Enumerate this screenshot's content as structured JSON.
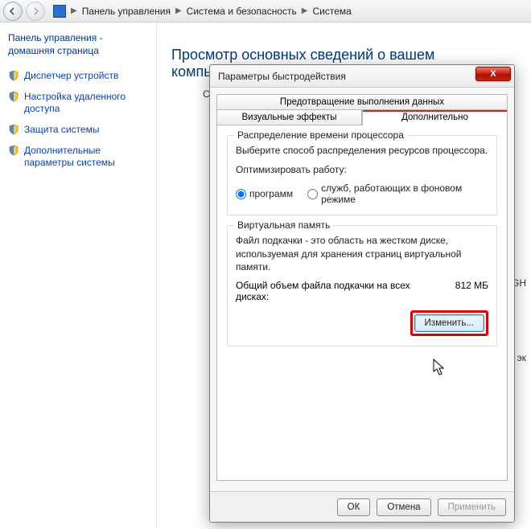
{
  "breadcrumb": {
    "item1": "Панель управления",
    "item2": "Система и безопасность",
    "item3": "Система"
  },
  "sidebar": {
    "home": "Панель управления - домашняя страница",
    "items": [
      {
        "label": "Диспетчер устройств"
      },
      {
        "label": "Настройка удаленного доступа"
      },
      {
        "label": "Защита системы"
      },
      {
        "label": "Дополнительные параметры системы"
      }
    ]
  },
  "page": {
    "heading": "Просмотр основных сведений о вашем компьютере"
  },
  "peek": {
    "left": "Св",
    "right1": "GH",
    "right2": "эк"
  },
  "dialog": {
    "title": "Параметры быстродействия",
    "close": "X",
    "tabs": {
      "dep": "Предотвращение выполнения данных",
      "visual": "Визуальные эффекты",
      "advanced": "Дополнительно"
    },
    "cpu": {
      "legend": "Распределение времени процессора",
      "desc": "Выберите способ распределения ресурсов процессора.",
      "optimize": "Оптимизировать работу:",
      "opt_programs": "программ",
      "opt_services": "служб, работающих в фоновом режиме"
    },
    "vm": {
      "legend": "Виртуальная память",
      "desc": "Файл подкачки - это область на жестком диске, используемая для хранения страниц виртуальной памяти.",
      "total_label": "Общий объем файла подкачки на всех дисках:",
      "total_value": "812 МБ",
      "change": "Изменить..."
    },
    "buttons": {
      "ok": "ОК",
      "cancel": "Отмена",
      "apply": "Применить"
    }
  }
}
